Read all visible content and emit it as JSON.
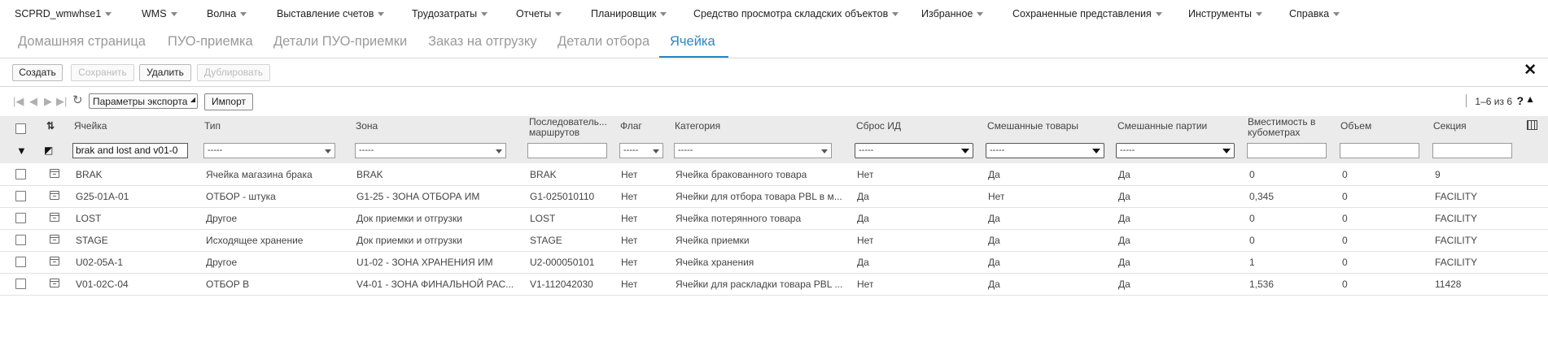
{
  "topmenu": [
    {
      "label": "SCPRD_wmwhse1"
    },
    {
      "label": "WMS"
    },
    {
      "label": "Волна"
    },
    {
      "label": "Выставление счетов"
    },
    {
      "label": "Трудозатраты"
    },
    {
      "label": "Отчеты"
    },
    {
      "label": "Планировщик"
    },
    {
      "label": "Средство просмотра складских объектов"
    },
    {
      "label": "Избранное"
    },
    {
      "label": "Сохраненные представления"
    },
    {
      "label": "Инструменты"
    },
    {
      "label": "Справка"
    }
  ],
  "tabs": [
    {
      "label": "Домашняя страница"
    },
    {
      "label": "ПУО-приемка"
    },
    {
      "label": "Детали ПУО-приемки"
    },
    {
      "label": "Заказ на отгрузку"
    },
    {
      "label": "Детали отбора"
    },
    {
      "label": "Ячейка"
    }
  ],
  "toolbar": {
    "create": "Создать",
    "save": "Сохранить",
    "delete": "Удалить",
    "duplicate": "Дублировать",
    "close": "✕"
  },
  "gridbar": {
    "export_params": "Параметры экспорта",
    "import": "Импорт",
    "pager": "1–6 из 6",
    "help": "?",
    "collapse": "^"
  },
  "columns": [
    "Ячейка",
    "Тип",
    "Зона",
    "Последователь... маршрутов",
    "Флаг",
    "Категория",
    "Сброс ИД",
    "Смешанные товары",
    "Смешанные партии",
    "Вместимость в кубометрах",
    "Объем",
    "Секция"
  ],
  "filters": {
    "cell": "brak and lost and v01-0",
    "type": "-----",
    "zone": "-----",
    "route_seq": "",
    "flag": "-----",
    "category": "-----",
    "reset_id": "-----",
    "mixed_goods": "-----",
    "mixed_lots": "-----",
    "capacity": "",
    "volume": "",
    "section": ""
  },
  "rows": [
    {
      "cell": "BRAK",
      "type": "Ячейка магазина брака",
      "zone": "BRAK",
      "route": "BRAK",
      "flag": "Нет",
      "category": "Ячейка бракованного товара",
      "reset": "Нет",
      "mixed_goods": "Да",
      "mixed_lots": "Да",
      "capacity": "0",
      "volume": "0",
      "section": "9"
    },
    {
      "cell": "G25-01A-01",
      "type": "ОТБОР - штука",
      "zone": "G1-25 - ЗОНА ОТБОРА ИМ",
      "route": "G1-025010110",
      "flag": "Нет",
      "category": "Ячейки для отбора товара PBL в м...",
      "reset": "Да",
      "mixed_goods": "Нет",
      "mixed_lots": "Да",
      "capacity": "0,345",
      "volume": "0",
      "section": "FACILITY"
    },
    {
      "cell": "LOST",
      "type": "Другое",
      "zone": "Док приемки и отгрузки",
      "route": "LOST",
      "flag": "Нет",
      "category": "Ячейка потерянного товара",
      "reset": "Да",
      "mixed_goods": "Да",
      "mixed_lots": "Да",
      "capacity": "0",
      "volume": "0",
      "section": "FACILITY"
    },
    {
      "cell": "STAGE",
      "type": "Исходящее хранение",
      "zone": "Док приемки и отгрузки",
      "route": "STAGE",
      "flag": "Нет",
      "category": "Ячейка приемки",
      "reset": "Нет",
      "mixed_goods": "Да",
      "mixed_lots": "Да",
      "capacity": "0",
      "volume": "0",
      "section": "FACILITY"
    },
    {
      "cell": "U02-05A-1",
      "type": "Другое",
      "zone": "U1-02 - ЗОНА ХРАНЕНИЯ ИМ",
      "route": "U2-000050101",
      "flag": "Нет",
      "category": "Ячейка хранения",
      "reset": "Да",
      "mixed_goods": "Да",
      "mixed_lots": "Да",
      "capacity": "1",
      "volume": "0",
      "section": "FACILITY"
    },
    {
      "cell": "V01-02C-04",
      "type": "ОТБОР В",
      "zone": "V4-01 - ЗОНА ФИНАЛЬНОЙ РАС...",
      "route": "V1-112042030",
      "flag": "Нет",
      "category": "Ячейки для раскладки товара PBL ...",
      "reset": "Нет",
      "mixed_goods": "Да",
      "mixed_lots": "Да",
      "capacity": "1,536",
      "volume": "0",
      "section": "11428"
    }
  ]
}
